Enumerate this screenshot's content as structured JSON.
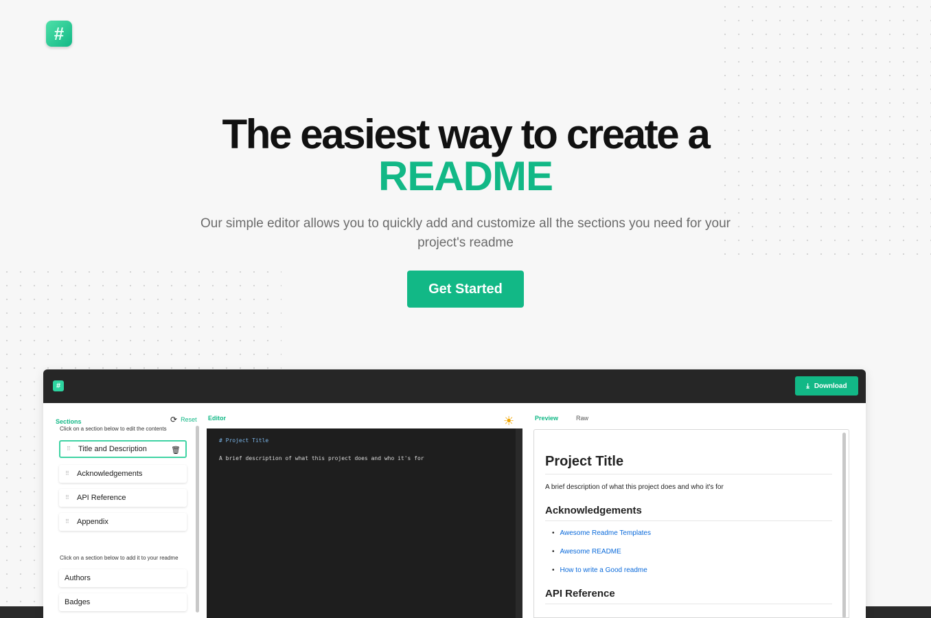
{
  "hero": {
    "title_line1": "The easiest way to create a",
    "title_highlight": "README",
    "subtitle": "Our simple editor allows you to quickly add and customize all the sections you need for your project's readme",
    "cta": "Get Started"
  },
  "app": {
    "download_label": "Download",
    "sections_label": "Sections",
    "reset_label": "Reset",
    "editor_label": "Editor",
    "edit_hint": "Click on a section below to edit the contents",
    "add_hint": "Click on a section below to add it to your readme",
    "active_sections": [
      "Title and Description",
      "Acknowledgements",
      "API Reference",
      "Appendix"
    ],
    "available_sections": [
      "Authors",
      "Badges"
    ],
    "editor_lines": [
      "# Project Title",
      "A brief description of what this project does and who it's for"
    ],
    "tab_preview": "Preview",
    "tab_raw": "Raw",
    "preview": {
      "h1": "Project Title",
      "description": "A brief description of what this project does and who it's for",
      "h2_ack": "Acknowledgements",
      "links": [
        "Awesome Readme Templates",
        "Awesome README",
        "How to write a Good readme"
      ],
      "h2_api": "API Reference"
    }
  },
  "colors": {
    "accent": "#12b886",
    "dark": "#262626",
    "link": "#0969da"
  }
}
